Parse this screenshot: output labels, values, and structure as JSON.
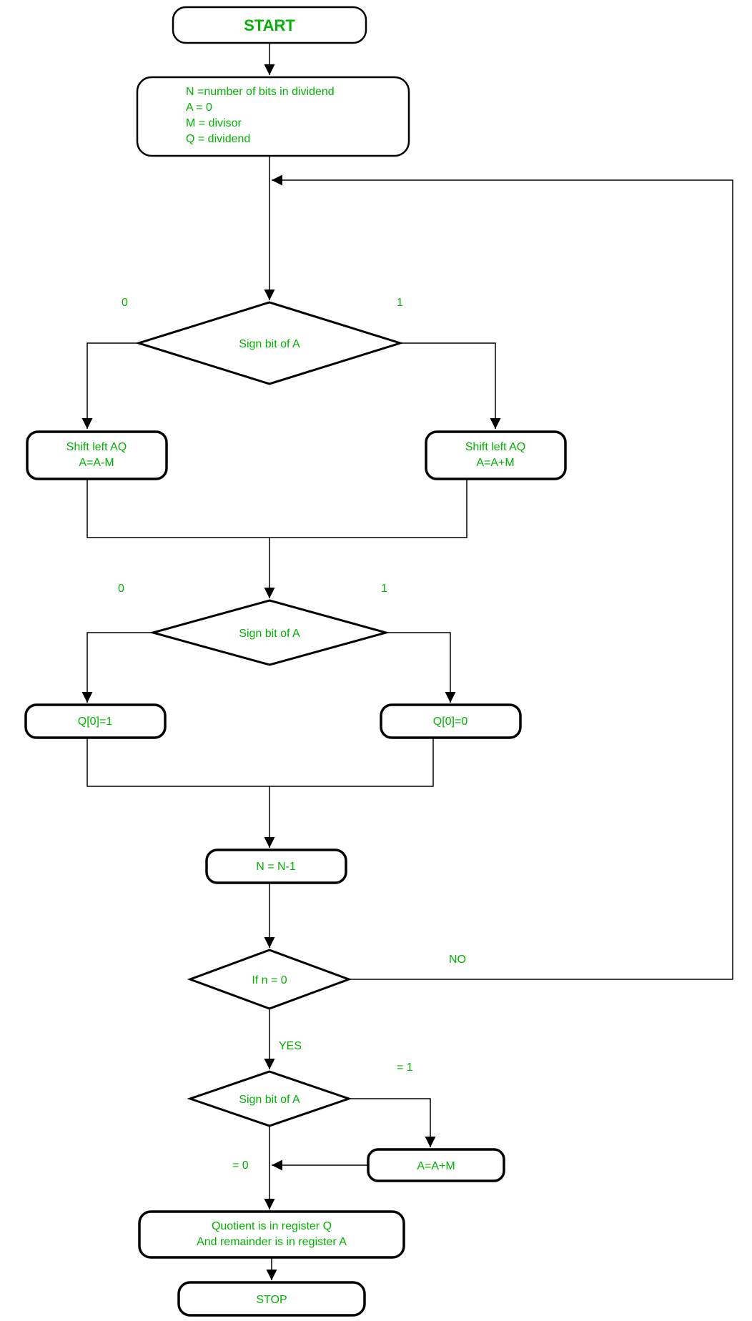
{
  "start": "START",
  "init": {
    "l1": "N  =number of bits in dividend",
    "l2": "A  = 0",
    "l3": "M = divisor",
    "l4": "Q = dividend"
  },
  "dec1": {
    "label": "Sign bit of A",
    "left": "0",
    "right": "1"
  },
  "shiftL": {
    "l1": "Shift left AQ",
    "l2": "A=A-M"
  },
  "shiftR": {
    "l1": "Shift left AQ",
    "l2": "A=A+M"
  },
  "dec2": {
    "label": "Sign bit of A",
    "left": "0",
    "right": "1"
  },
  "qL": "Q[0]=1",
  "qR": "Q[0]=0",
  "decr": "N = N-1",
  "dec3": {
    "label": "If n = 0",
    "no": "NO",
    "yes": "YES"
  },
  "dec4": {
    "label": "Sign bit of A",
    "eq1": "= 1",
    "eq0": "= 0"
  },
  "restore": "A=A+M",
  "result": {
    "l1": "Quotient is in register Q",
    "l2": "And remainder is in register A"
  },
  "stop": "STOP"
}
